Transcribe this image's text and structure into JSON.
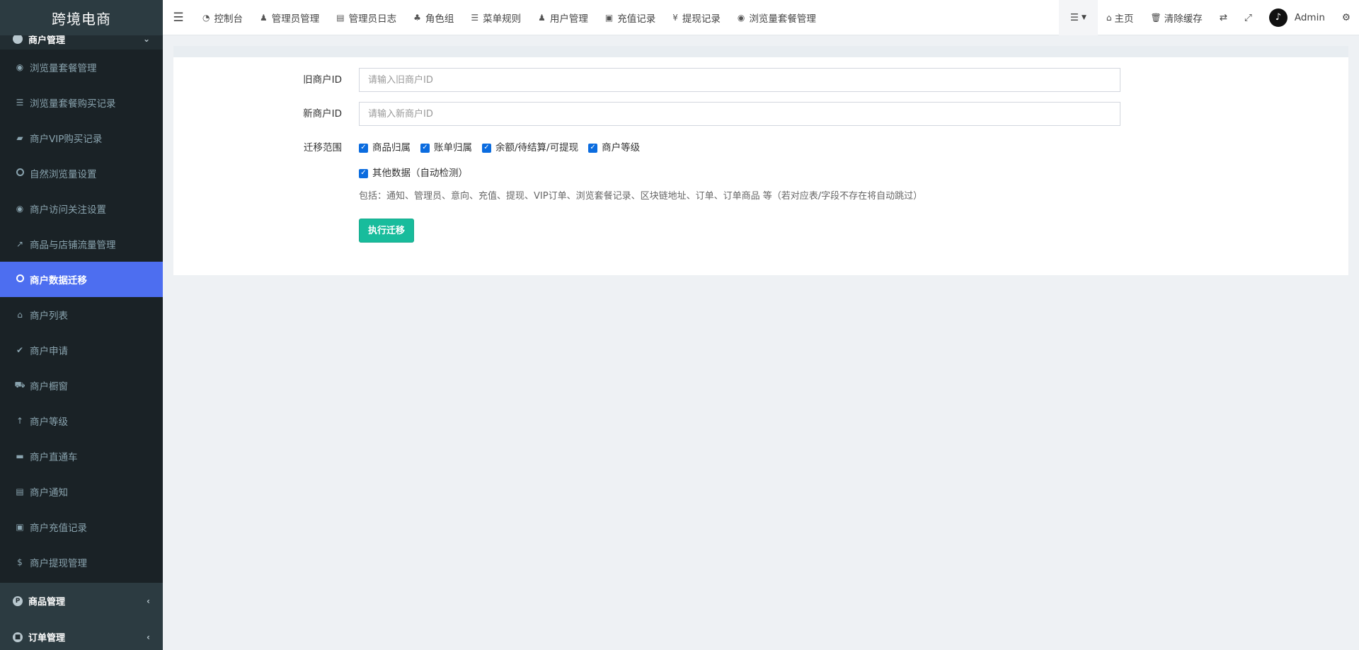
{
  "app": {
    "title": "跨境电商"
  },
  "sidebar": {
    "active_group": {
      "label": "商户管理",
      "icon": "apple-icon"
    },
    "items": [
      {
        "label": "浏览量套餐管理",
        "icon": "eye-icon"
      },
      {
        "label": "浏览量套餐购买记录",
        "icon": "list-icon"
      },
      {
        "label": "商户VIP购买记录",
        "icon": "bag-icon"
      },
      {
        "label": "自然浏览量设置",
        "icon": "circle-icon"
      },
      {
        "label": "商户访问关注设置",
        "icon": "eye-icon"
      },
      {
        "label": "商品与店铺流量管理",
        "icon": "line-chart-icon"
      },
      {
        "label": "商户数据迁移",
        "icon": "circle-icon",
        "active": true
      },
      {
        "label": "商户列表",
        "icon": "home-icon"
      },
      {
        "label": "商户申请",
        "icon": "check-circle-icon"
      },
      {
        "label": "商户橱窗",
        "icon": "cart-icon"
      },
      {
        "label": "商户等级",
        "icon": "level-up-icon"
      },
      {
        "label": "商户直通车",
        "icon": "car-icon"
      },
      {
        "label": "商户通知",
        "icon": "newspaper-icon"
      },
      {
        "label": "商户充值记录",
        "icon": "money-icon"
      },
      {
        "label": "商户提现管理",
        "icon": "dollar-icon"
      }
    ],
    "collapsed_groups": [
      {
        "label": "商品管理",
        "icon": "product-hunt-icon"
      },
      {
        "label": "订单管理",
        "icon": "cube-icon"
      }
    ]
  },
  "navbar": {
    "tabs": [
      {
        "label": "控制台",
        "icon": "dashboard-icon",
        "glyph": "◔"
      },
      {
        "label": "管理员管理",
        "icon": "user-icon",
        "glyph": "♟"
      },
      {
        "label": "管理员日志",
        "icon": "list-alt-icon",
        "glyph": "▤"
      },
      {
        "label": "角色组",
        "icon": "group-icon",
        "glyph": "♣"
      },
      {
        "label": "菜单规则",
        "icon": "bars-icon",
        "glyph": "☰"
      },
      {
        "label": "用户管理",
        "icon": "user-icon",
        "glyph": "♟"
      },
      {
        "label": "充值记录",
        "icon": "money-icon",
        "glyph": "▣"
      },
      {
        "label": "提现记录",
        "icon": "yen-icon",
        "glyph": "¥"
      },
      {
        "label": "浏览量套餐管理",
        "icon": "eye-icon",
        "glyph": "◉"
      }
    ],
    "home_label": "主页",
    "clear_cache_label": "清除缓存",
    "user_name": "Admin"
  },
  "form": {
    "old_id": {
      "label": "旧商户ID",
      "placeholder": "请输入旧商户ID",
      "value": ""
    },
    "new_id": {
      "label": "新商户ID",
      "placeholder": "请输入新商户ID",
      "value": ""
    },
    "scope": {
      "label": "迁移范围",
      "options": [
        {
          "label": "商品归属",
          "checked": true
        },
        {
          "label": "账单归属",
          "checked": true
        },
        {
          "label": "余额/待结算/可提现",
          "checked": true
        },
        {
          "label": "商户等级",
          "checked": true
        },
        {
          "label": "其他数据（自动检测）",
          "checked": true
        }
      ],
      "help": "包括：通知、管理员、意向、充值、提现、VIP订单、浏览套餐记录、区块链地址、订单、订单商品 等（若对应表/字段不存在将自动跳过）"
    },
    "submit_label": "执行迁移"
  },
  "colors": {
    "sidebar_bg": "#222d32",
    "active_item": "#4d6ef0",
    "primary_button": "#18bc9c",
    "checkbox": "#0b6cdf"
  }
}
